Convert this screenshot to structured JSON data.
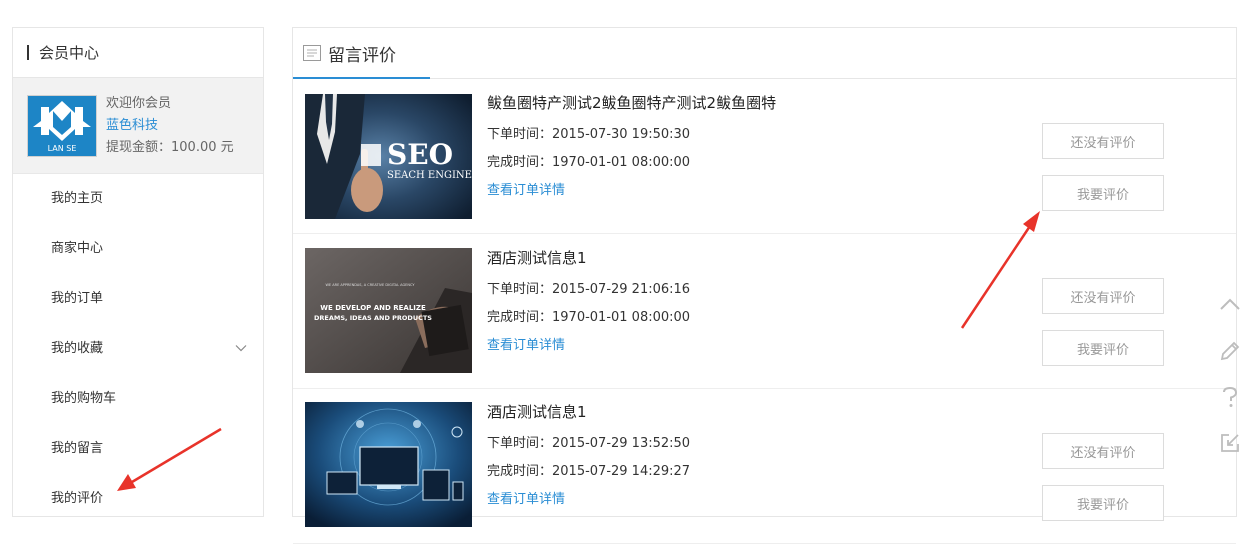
{
  "sidebar": {
    "title": "会员中心",
    "profile": {
      "welcome": "欢迎你会员",
      "company": "蓝色科技",
      "balance": "提现金额：100.00 元",
      "logo_text": "LAN SE"
    },
    "items": [
      {
        "label": "我的主页"
      },
      {
        "label": "商家中心"
      },
      {
        "label": "我的订单"
      },
      {
        "label": "我的收藏"
      },
      {
        "label": "我的购物车"
      },
      {
        "label": "我的留言"
      },
      {
        "label": "我的评价"
      }
    ]
  },
  "main": {
    "title": "留言评价",
    "orders": [
      {
        "name": "鲅鱼圈特产测试2鲅鱼圈特产测试2鲅鱼圈特",
        "order_time": "下单时间：2015-07-30 19:50:30",
        "finish_time": "完成时间：1970-01-01 08:00:00",
        "detail_link": "查看订单详情",
        "status_btn": "还没有评价",
        "review_btn": "我要评价",
        "thumb": {
          "line1": "SEO",
          "line2": "SEACH ENGINE"
        }
      },
      {
        "name": "酒店测试信息1",
        "order_time": "下单时间：2015-07-29 21:06:16",
        "finish_time": "完成时间：1970-01-01 08:00:00",
        "detail_link": "查看订单详情",
        "status_btn": "还没有评价",
        "review_btn": "我要评价",
        "thumb": {
          "line0": "WE ARE APPRENDAS, A CREATIVE DIGITAL AGENCY",
          "line1": "WE DEVELOP AND REALIZE",
          "line2": "DREAMS, IDEAS AND PRODUCTS"
        }
      },
      {
        "name": "酒店测试信息1",
        "order_time": "下单时间：2015-07-29 13:52:50",
        "finish_time": "完成时间：2015-07-29 14:29:27",
        "detail_link": "查看订单详情",
        "status_btn": "还没有评价",
        "review_btn": "我要评价"
      }
    ]
  },
  "tools": [
    "back-to-top-icon",
    "edit-icon",
    "help-icon",
    "share-icon"
  ],
  "colors": {
    "accent": "#2a8dd4",
    "arrow": "#e8332a"
  }
}
